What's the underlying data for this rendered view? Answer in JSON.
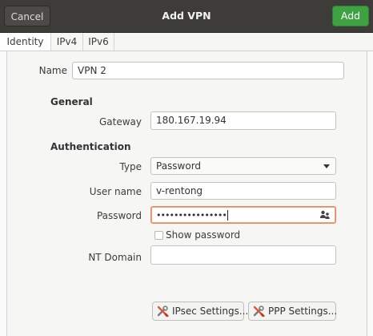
{
  "titlebar": {
    "cancel_label": "Cancel",
    "title": "Add VPN",
    "add_label": "Add"
  },
  "tabs": [
    {
      "label": "Identity",
      "active": true
    },
    {
      "label": "IPv4",
      "active": false
    },
    {
      "label": "IPv6",
      "active": false
    }
  ],
  "identity": {
    "name_label": "Name",
    "name_value": "VPN 2"
  },
  "general": {
    "heading": "General",
    "gateway_label": "Gateway",
    "gateway_value": "180.167.19.94"
  },
  "authentication": {
    "heading": "Authentication",
    "type_label": "Type",
    "type_value": "Password",
    "username_label": "User name",
    "username_value": "v-rentong",
    "password_label": "Password",
    "password_masked": "••••••••••••••••",
    "password_icon": "user-group-icon",
    "show_password_label": "Show password",
    "show_password_checked": false,
    "nt_domain_label": "NT Domain",
    "nt_domain_value": ""
  },
  "buttons": {
    "ipsec_label": "IPsec Settings...",
    "ppp_label": "PPP Settings...",
    "icon": "wrench-screwdriver-icon"
  },
  "colors": {
    "titlebar": "#3d3c38",
    "add_button": "#3ea142",
    "focus_border": "#e9845e"
  }
}
